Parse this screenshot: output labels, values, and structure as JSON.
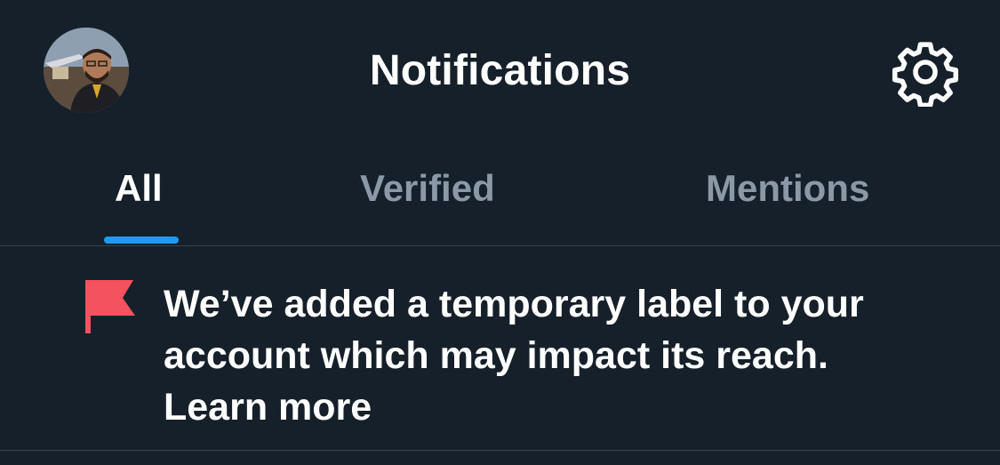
{
  "header": {
    "title": "Notifications",
    "avatar_icon": "profile-photo",
    "settings_icon": "gear-icon"
  },
  "tabs": [
    {
      "label": "All",
      "active": true
    },
    {
      "label": "Verified",
      "active": false
    },
    {
      "label": "Mentions",
      "active": false
    }
  ],
  "notice": {
    "icon": "flag-icon",
    "line1": "We’ve added a temporary label to your",
    "line2": "account which may impact its reach.",
    "link_label": "Learn more"
  },
  "colors": {
    "background": "#15202b",
    "text_primary": "#ffffff",
    "text_secondary": "#8b98a5",
    "accent": "#1d9bf0",
    "flag": "#f4525e",
    "divider": "#38444d"
  }
}
